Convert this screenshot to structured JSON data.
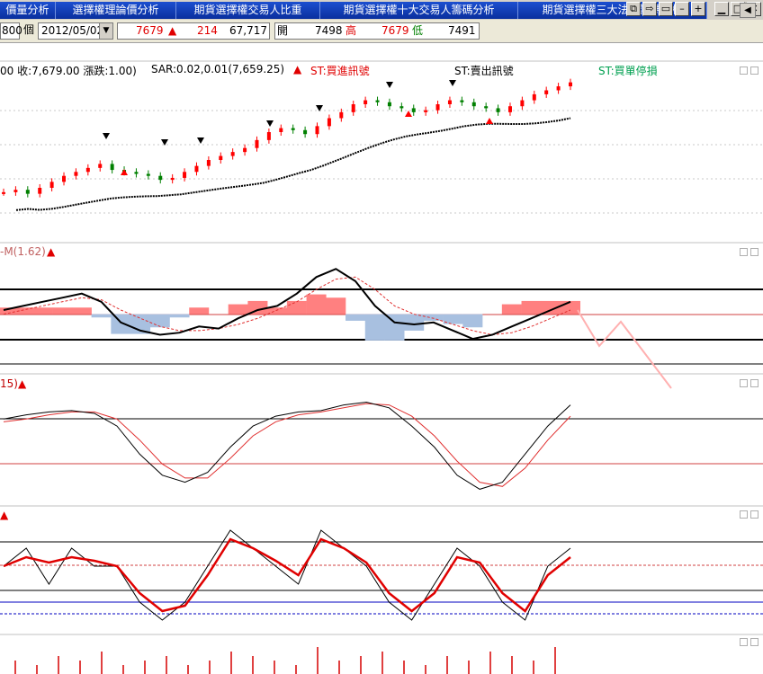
{
  "tabs": [
    "價量分析",
    "選擇權理論價分析",
    "期貨選擇權交易人比重",
    "期貨選擇權十大交易人籌碼分析",
    "期貨選擇權三大法人籌碼分析"
  ],
  "window_buttons": [
    "restore-window-icon",
    "arrow-icon",
    "display-icon",
    "minimize-icon",
    "add-icon",
    "restore-icon",
    "maximize-icon",
    "close-icon"
  ],
  "quote": {
    "partial_num": "800",
    "unit": "個",
    "date": "2012/05/02",
    "price": "7679",
    "change": "214",
    "volume": "67,717",
    "open_label": "開",
    "open": "7498",
    "high_label": "高",
    "high": "7679",
    "low_label": "低",
    "low": "7491"
  },
  "price_pane": {
    "info": "00 收:7,679.00 漲跌:1.00)",
    "sar": "SAR:0.02,0.01(7,659.25)",
    "buy_signal": "ST:買進訊號",
    "sell_signal": "ST:賣出訊號",
    "stop_signal": "ST:買單停損"
  },
  "indicator1": {
    "label": "-M(1.62)"
  },
  "indicator2": {
    "label": "15)"
  },
  "indicator3": {
    "label": ""
  },
  "colors": {
    "tab_bg": "#1c4fd0",
    "up": "#ff0000",
    "signal_buy": "#ff0000",
    "signal_stop": "#00a050",
    "hist_pos": "#ff8080",
    "hist_neg": "#a8c0e0",
    "ma_line": "#000000",
    "dim": "#c00000"
  },
  "chart_data": {
    "type": "line",
    "price_series": [
      7498,
      7510,
      7490,
      7520,
      7550,
      7580,
      7600,
      7620,
      7640,
      7610,
      7600,
      7590,
      7580,
      7560,
      7570,
      7600,
      7630,
      7660,
      7680,
      7700,
      7720,
      7760,
      7800,
      7820,
      7810,
      7790,
      7830,
      7870,
      7900,
      7940,
      7960,
      7950,
      7930,
      7920,
      7900,
      7910,
      7940,
      7960,
      7950,
      7930,
      7920,
      7900,
      7930,
      7960,
      7990,
      8010,
      8030,
      8050
    ],
    "macd_line": [
      0.1,
      0.2,
      0.3,
      0.4,
      0.5,
      0.3,
      -0.2,
      -0.4,
      -0.5,
      -0.45,
      -0.3,
      -0.35,
      -0.1,
      0.1,
      0.2,
      0.5,
      0.9,
      1.1,
      0.8,
      0.2,
      -0.2,
      -0.25,
      -0.2,
      -0.4,
      -0.6,
      -0.5,
      -0.3,
      -0.1,
      0.1,
      0.3
    ],
    "macd_signal": [
      0.0,
      0.1,
      0.2,
      0.3,
      0.4,
      0.35,
      0.1,
      -0.1,
      -0.3,
      -0.4,
      -0.4,
      -0.35,
      -0.25,
      -0.1,
      0.1,
      0.3,
      0.6,
      0.85,
      0.9,
      0.6,
      0.2,
      0.0,
      -0.1,
      -0.25,
      -0.4,
      -0.5,
      -0.45,
      -0.3,
      -0.1,
      0.1
    ],
    "k_series": [
      60,
      63,
      65,
      66,
      64,
      55,
      35,
      20,
      15,
      22,
      40,
      55,
      62,
      65,
      66,
      70,
      72,
      68,
      55,
      40,
      20,
      10,
      15,
      35,
      55,
      70
    ],
    "d_series": [
      58,
      60,
      63,
      65,
      65,
      60,
      45,
      28,
      18,
      18,
      32,
      48,
      58,
      63,
      65,
      68,
      71,
      70,
      62,
      48,
      30,
      15,
      12,
      25,
      45,
      62
    ],
    "osc_fast": [
      0,
      1,
      -1,
      1,
      0,
      0,
      -2,
      -3,
      -2,
      0,
      2,
      1,
      0,
      -1,
      2,
      1,
      0,
      -2,
      -3,
      -1,
      1,
      0,
      -2,
      -3,
      0,
      1
    ],
    "osc_slow": [
      0,
      0.5,
      0.2,
      0.5,
      0.3,
      0,
      -1.5,
      -2.5,
      -2.2,
      -0.5,
      1.5,
      1,
      0.3,
      -0.5,
      1.5,
      1,
      0.2,
      -1.5,
      -2.5,
      -1.5,
      0.5,
      0.2,
      -1.5,
      -2.5,
      -0.5,
      0.5
    ],
    "volume": [
      3,
      2,
      4,
      3,
      5,
      2,
      3,
      4,
      2,
      3,
      5,
      4,
      3,
      2,
      6,
      3,
      4,
      5,
      3,
      2,
      4,
      3,
      5,
      4,
      3,
      6
    ]
  }
}
